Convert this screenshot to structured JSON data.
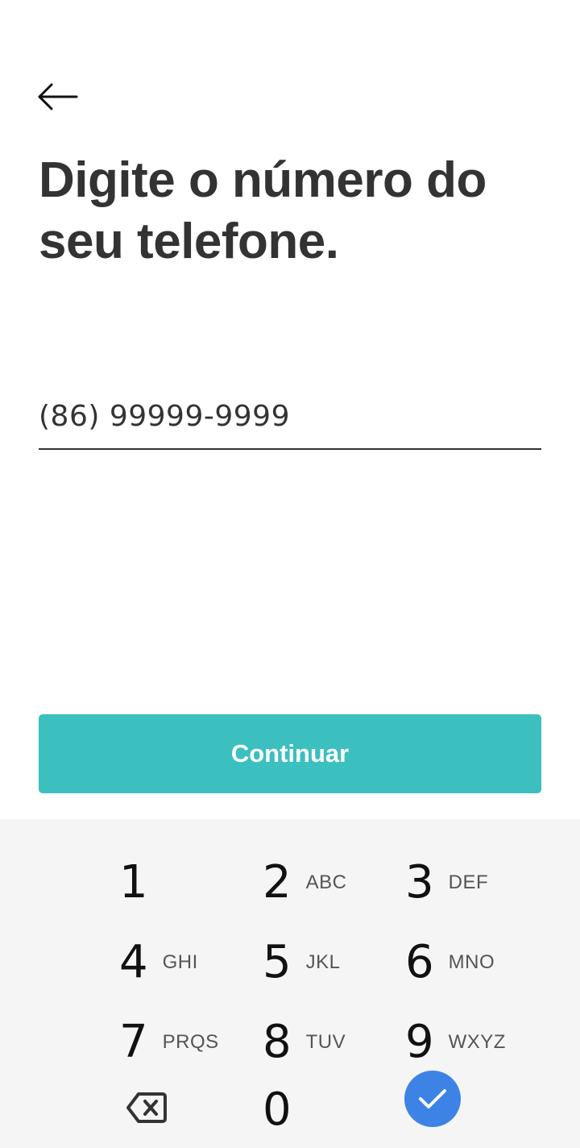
{
  "header": {
    "back_icon": "arrow-left-icon"
  },
  "title": "Digite o número do seu telefone.",
  "phone": {
    "value": "(86) 99999-9999",
    "placeholder": ""
  },
  "continue_button": {
    "label": "Continuar",
    "color": "#3bbfbf"
  },
  "keypad": {
    "background": "#f5f5f5",
    "keys": [
      {
        "digit": "1",
        "letters": ""
      },
      {
        "digit": "2",
        "letters": "ABC"
      },
      {
        "digit": "3",
        "letters": "DEF"
      },
      {
        "digit": "4",
        "letters": "GHI"
      },
      {
        "digit": "5",
        "letters": "JKL"
      },
      {
        "digit": "6",
        "letters": "MNO"
      },
      {
        "digit": "7",
        "letters": "PRQS"
      },
      {
        "digit": "8",
        "letters": "TUV"
      },
      {
        "digit": "9",
        "letters": "WXYZ"
      },
      {
        "digit": "0",
        "letters": ""
      }
    ],
    "backspace_icon": "backspace-icon",
    "confirm_icon": "checkmark-icon",
    "confirm_color": "#3d83e6"
  }
}
